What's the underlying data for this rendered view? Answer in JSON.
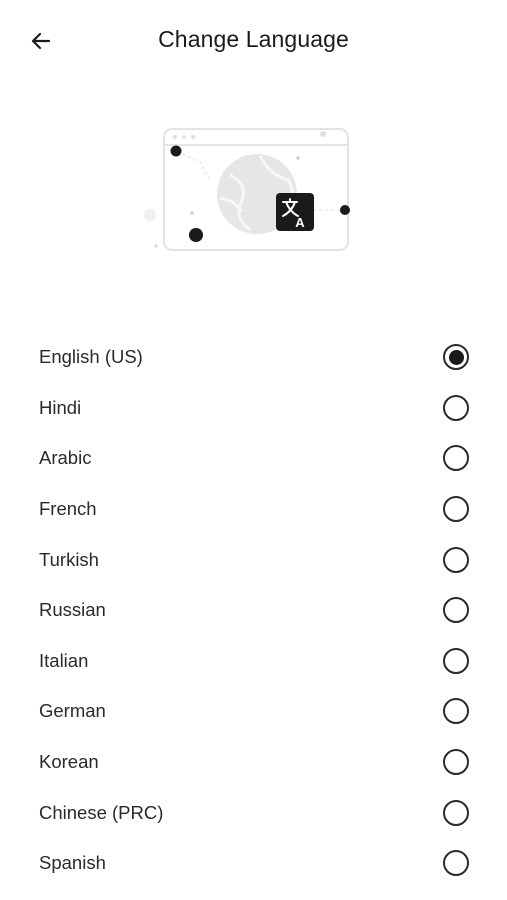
{
  "header": {
    "title": "Change Language",
    "back_icon": "arrow-left-icon"
  },
  "illustration": {
    "icon": "translate-icon",
    "translate_glyph_a": "A"
  },
  "languages": {
    "selected": "English (US)",
    "items": [
      {
        "label": "English (US)",
        "selected": true
      },
      {
        "label": "Hindi",
        "selected": false
      },
      {
        "label": "Arabic",
        "selected": false
      },
      {
        "label": "French",
        "selected": false
      },
      {
        "label": "Turkish",
        "selected": false
      },
      {
        "label": "Russian",
        "selected": false
      },
      {
        "label": "Italian",
        "selected": false
      },
      {
        "label": "German",
        "selected": false
      },
      {
        "label": "Korean",
        "selected": false
      },
      {
        "label": "Chinese (PRC)",
        "selected": false
      },
      {
        "label": "Spanish",
        "selected": false
      }
    ]
  },
  "colors": {
    "accent": "#1a1a1a",
    "background": "#ffffff",
    "illustration_gray": "#e4e4e4"
  }
}
